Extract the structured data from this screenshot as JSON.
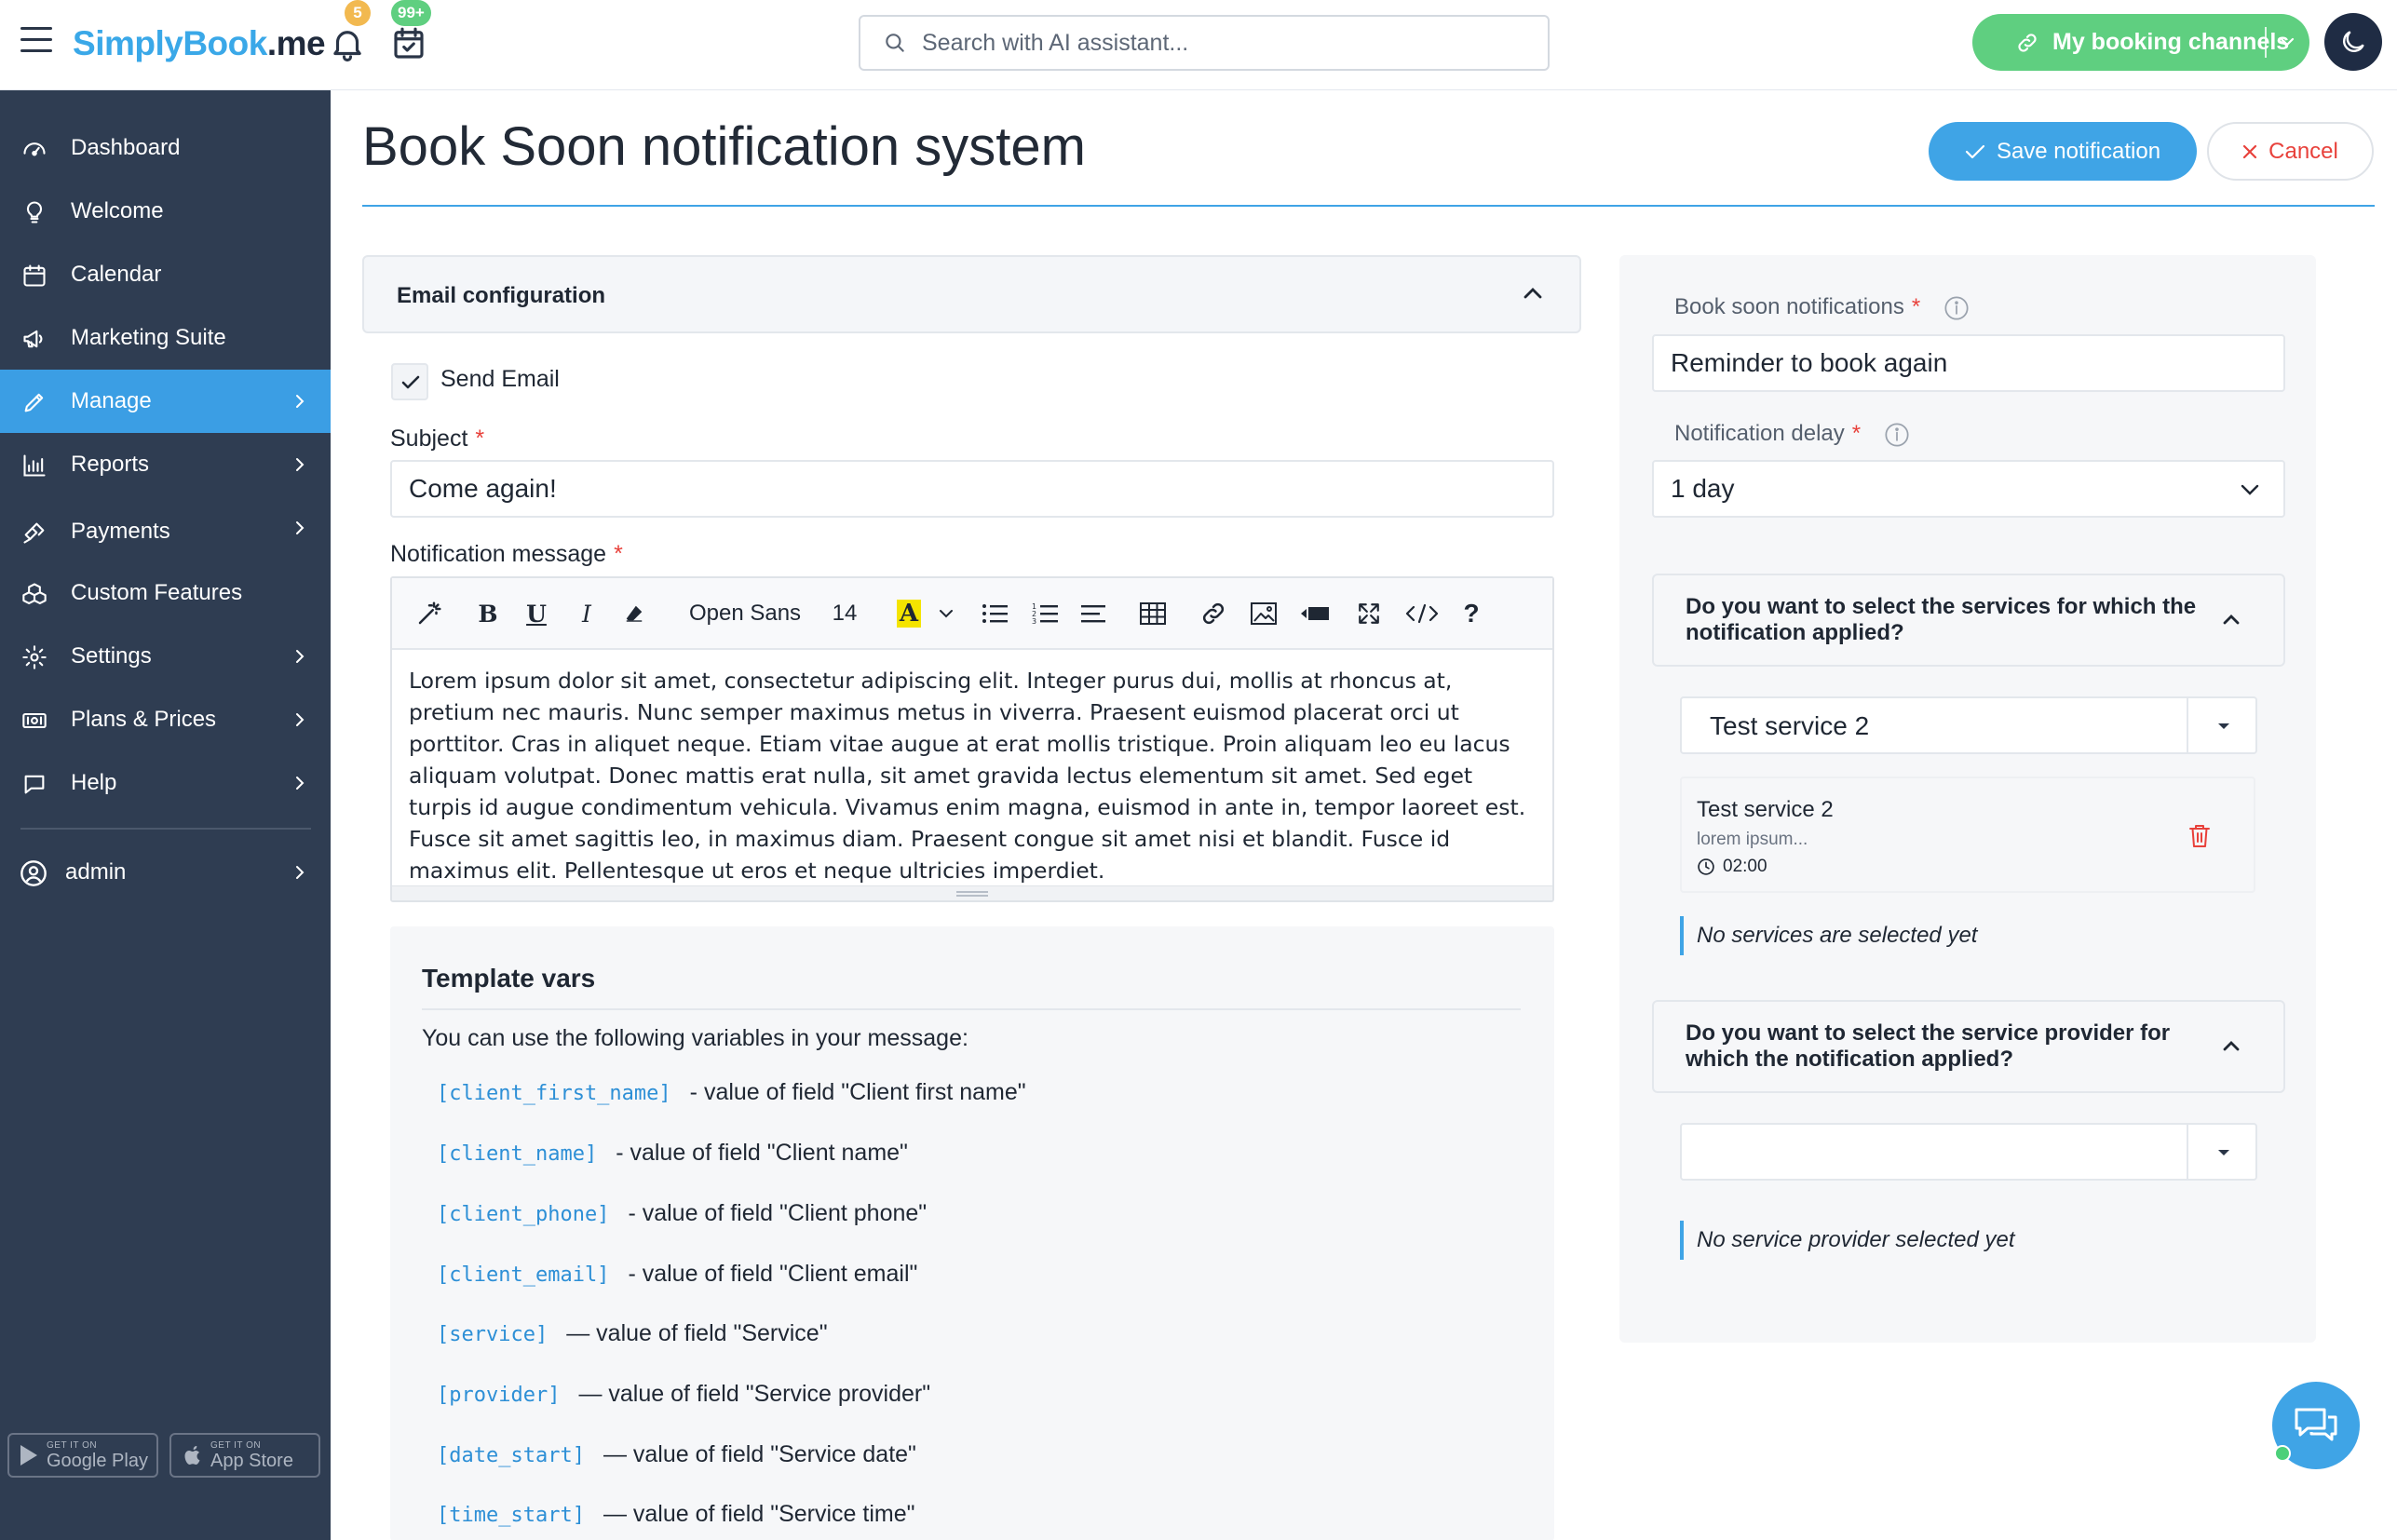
{
  "header": {
    "logo_s": "S",
    "logo_text": "implyBook",
    "logo_me": ".me",
    "notifications_badge": "5",
    "bookings_badge": "99+",
    "search_placeholder": "Search with AI assistant...",
    "channels_label": "My booking channels",
    "colors": {
      "accent": "#3fa4e6",
      "green": "#5fcf80",
      "badge_orange": "#f2b950",
      "badge_green": "#5fcf80"
    }
  },
  "sidebar": {
    "items": [
      {
        "label": "Dashboard",
        "icon": "dashboard-icon"
      },
      {
        "label": "Welcome",
        "icon": "bulb-icon"
      },
      {
        "label": "Calendar",
        "icon": "calendar-icon"
      },
      {
        "label": "Marketing Suite",
        "icon": "megaphone-icon"
      },
      {
        "label": "Manage",
        "icon": "pencil-icon"
      },
      {
        "label": "Reports",
        "icon": "chart-icon"
      },
      {
        "label": "Payments",
        "icon": "pay-icon"
      },
      {
        "label": "Custom Features",
        "icon": "boxes-icon"
      },
      {
        "label": "Settings",
        "icon": "gear-icon"
      },
      {
        "label": "Plans & Prices",
        "icon": "money-icon"
      },
      {
        "label": "Help",
        "icon": "chat-icon"
      }
    ],
    "user": "admin",
    "google_play_small": "GET IT ON",
    "google_play": "Google Play",
    "app_store_small": "GET IT ON",
    "app_store": "App Store"
  },
  "main": {
    "title": "Book Soon notification system",
    "save_label": "Save notification",
    "cancel_label": "Cancel",
    "email_config_label": "Email configuration",
    "send_email_label": "Send Email",
    "subject_label": "Subject",
    "subject_value": "Come again!",
    "message_label": "Notification message",
    "toolbar": {
      "font": "Open Sans",
      "size": "14",
      "color_letter": "A",
      "help": "?"
    },
    "message_body": "Lorem ipsum dolor sit amet, consectetur adipiscing elit. Integer purus dui, mollis at rhoncus at, pretium nec mauris. Nunc semper maximus metus in viverra. Praesent euismod placerat orci ut porttitor. Cras in aliquet neque. Etiam vitae augue at erat mollis tristique. Proin aliquam leo eu lacus aliquam volutpat. Donec mattis erat nulla, sit amet gravida lectus elementum sit amet. Sed eget turpis id augue condimentum vehicula. Vivamus enim magna, euismod in ante in, tempor laoreet est. Fusce sit amet sagittis leo, in maximus diam. Praesent congue sit amet nisi et blandit. Fusce id maximus elit. Pellentesque ut eros et neque ultricies imperdiet.",
    "template_vars": {
      "title": "Template vars",
      "intro": "You can use the following variables in your message:",
      "items": [
        {
          "code": "[client_first_name]",
          "desc": "- value of field \"Client first name\""
        },
        {
          "code": "[client_name]",
          "desc": "- value of field \"Client name\""
        },
        {
          "code": "[client_phone]",
          "desc": "- value of field \"Client phone\""
        },
        {
          "code": "[client_email]",
          "desc": "- value of field \"Client email\""
        },
        {
          "code": "[service]",
          "desc": "— value of field \"Service\""
        },
        {
          "code": "[provider]",
          "desc": "— value of field \"Service provider\""
        },
        {
          "code": "[date_start]",
          "desc": "— value of field \"Service date\""
        },
        {
          "code": "[time_start]",
          "desc": "— value of field \"Service time\""
        }
      ]
    }
  },
  "panel": {
    "book_soon_label": "Book soon notifications",
    "book_soon_value": "Reminder to book again",
    "delay_label": "Notification delay",
    "delay_value": "1 day",
    "services_question": "Do you want to select the services for which the notification applied?",
    "service_select_value": "Test service 2",
    "service_card": {
      "name": "Test service 2",
      "desc": "lorem ipsum...",
      "duration": "02:00"
    },
    "no_services_note": "No services are selected yet",
    "provider_question": "Do you want to select the service provider for which the notification applied?",
    "provider_select_value": "",
    "no_provider_note": "No service provider selected yet"
  }
}
